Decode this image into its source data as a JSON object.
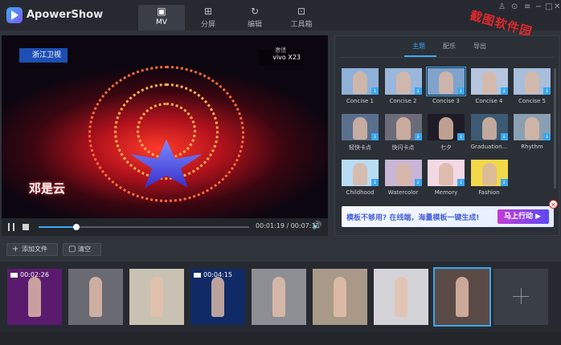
{
  "app": {
    "title": "ApowerShow"
  },
  "main_tabs": [
    {
      "label": "MV",
      "icon": "mv-icon"
    },
    {
      "label": "分屏",
      "icon": "split-screen-icon"
    },
    {
      "label": "编辑",
      "icon": "edit-refresh-icon"
    },
    {
      "label": "工具箱",
      "icon": "toolbox-icon"
    }
  ],
  "window_controls": [
    "user-icon",
    "lock-icon",
    "menu-icon",
    "minimize-icon",
    "maximize-icon",
    "close-icon"
  ],
  "watermark": "截图软件园",
  "preview": {
    "channel_logo": "浙江卫视",
    "sponsor": "vivo X23",
    "sponsor_tag": "邀请",
    "caption": "邓是云"
  },
  "player": {
    "current_time": "00:01:19",
    "total_time": "00:07:11",
    "progress": 0.18
  },
  "panel_tabs": [
    {
      "label": "主题",
      "active": true
    },
    {
      "label": "配乐",
      "active": false
    },
    {
      "label": "导出",
      "active": false
    }
  ],
  "themes": [
    {
      "label": "Concise 1",
      "color": "#8fb0d8",
      "badge": true,
      "selected": false
    },
    {
      "label": "Concise 2",
      "color": "#9ab7dc",
      "badge": true,
      "selected": false
    },
    {
      "label": "Concise 3",
      "color": "#7fa3cc",
      "badge": true,
      "selected": true
    },
    {
      "label": "Concise 4",
      "color": "#b5c6de",
      "badge": true,
      "selected": false
    },
    {
      "label": "Concise 5",
      "color": "#a8bedb",
      "badge": true,
      "selected": false
    },
    {
      "label": "轻快卡点",
      "color": "#5a6f8e",
      "badge": true,
      "selected": false
    },
    {
      "label": "快闪卡点",
      "color": "#6b6b7a",
      "badge": true,
      "selected": false
    },
    {
      "label": "七夕",
      "color": "#1f1b26",
      "badge": true,
      "selected": false
    },
    {
      "label": "Graduation...",
      "color": "#3c5a72",
      "badge": true,
      "selected": false
    },
    {
      "label": "Rhythm",
      "color": "#8aa0b2",
      "badge": true,
      "selected": false
    },
    {
      "label": "Childhood",
      "color": "#b9dcf5",
      "badge": true,
      "selected": false
    },
    {
      "label": "Watercolor",
      "color": "#c9b5d6",
      "badge": true,
      "selected": false
    },
    {
      "label": "Memory",
      "color": "#f3d9e4",
      "badge": true,
      "selected": false
    },
    {
      "label": "Fashion",
      "color": "#f2d94a",
      "badge": true,
      "selected": false
    }
  ],
  "promo": {
    "text": "模板不够用? 在线端，海量模板一键生成!",
    "button": "马上行动 ▶"
  },
  "toolbar": {
    "add_file": "添加文件",
    "clear": "清空"
  },
  "clips": [
    {
      "color": "#5a1a6e",
      "duration": "00:02:26",
      "video": true,
      "selected": false
    },
    {
      "color": "#6a6a72",
      "duration": "",
      "video": false,
      "selected": false
    },
    {
      "color": "#c9c2b2",
      "duration": "",
      "video": false,
      "selected": false
    },
    {
      "color": "#102a66",
      "duration": "00:04:15",
      "video": true,
      "selected": false
    },
    {
      "color": "#8d8f94",
      "duration": "",
      "video": false,
      "selected": false
    },
    {
      "color": "#a89988",
      "duration": "",
      "video": false,
      "selected": false
    },
    {
      "color": "#d3d3d8",
      "duration": "",
      "video": false,
      "selected": false
    },
    {
      "color": "#5a4a46",
      "duration": "",
      "video": false,
      "selected": true
    }
  ]
}
